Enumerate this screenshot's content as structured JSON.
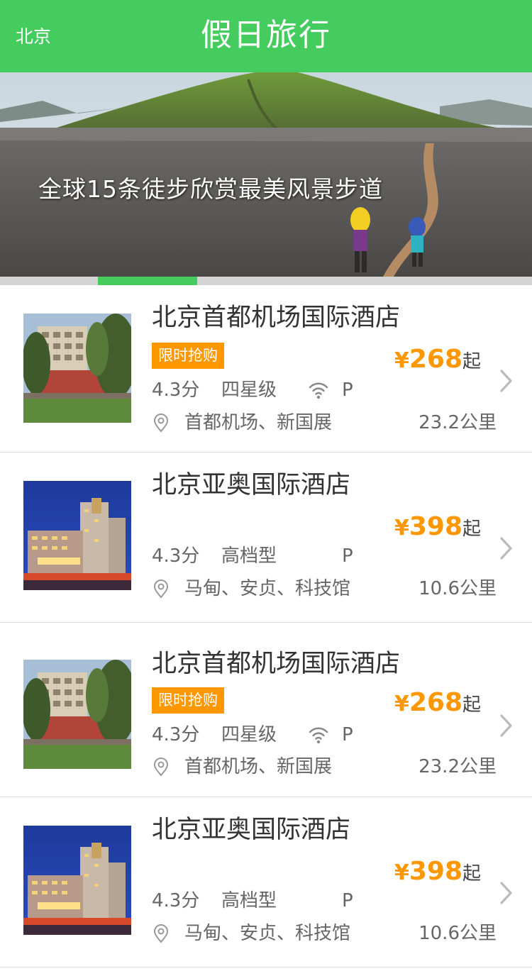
{
  "header": {
    "city": "北京",
    "title": "假日旅行"
  },
  "banner": {
    "caption": "全球15条徒步欣赏最美风景步道",
    "active_index": 1,
    "slide_count": 5
  },
  "colors": {
    "brand_green": "#44cc5f",
    "accent_orange": "#ff9700"
  },
  "hotels": [
    {
      "name": "北京首都机场国际酒店",
      "badge": "限时抢购",
      "score": "4.3分",
      "grade": "四星级",
      "wifi": true,
      "parking": "P",
      "area": "首都机场、新国展",
      "distance": "23.2公里",
      "currency": "¥",
      "price": "268",
      "price_suffix": "起",
      "thumb_icon": "hotel-photo-airport"
    },
    {
      "name": "北京亚奥国际酒店",
      "badge": "",
      "score": "4.3分",
      "grade": "高档型",
      "wifi": false,
      "parking": "P",
      "area": "马甸、安贞、科技馆",
      "distance": "10.6公里",
      "currency": "¥",
      "price": "398",
      "price_suffix": "起",
      "thumb_icon": "hotel-photo-night"
    },
    {
      "name": "北京首都机场国际酒店",
      "badge": "限时抢购",
      "score": "4.3分",
      "grade": "四星级",
      "wifi": true,
      "parking": "P",
      "area": "首都机场、新国展",
      "distance": "23.2公里",
      "currency": "¥",
      "price": "268",
      "price_suffix": "起",
      "thumb_icon": "hotel-photo-airport"
    },
    {
      "name": "北京亚奥国际酒店",
      "badge": "",
      "score": "4.3分",
      "grade": "高档型",
      "wifi": false,
      "parking": "P",
      "area": "马甸、安贞、科技馆",
      "distance": "10.6公里",
      "currency": "¥",
      "price": "398",
      "price_suffix": "起",
      "thumb_icon": "hotel-photo-night"
    }
  ]
}
